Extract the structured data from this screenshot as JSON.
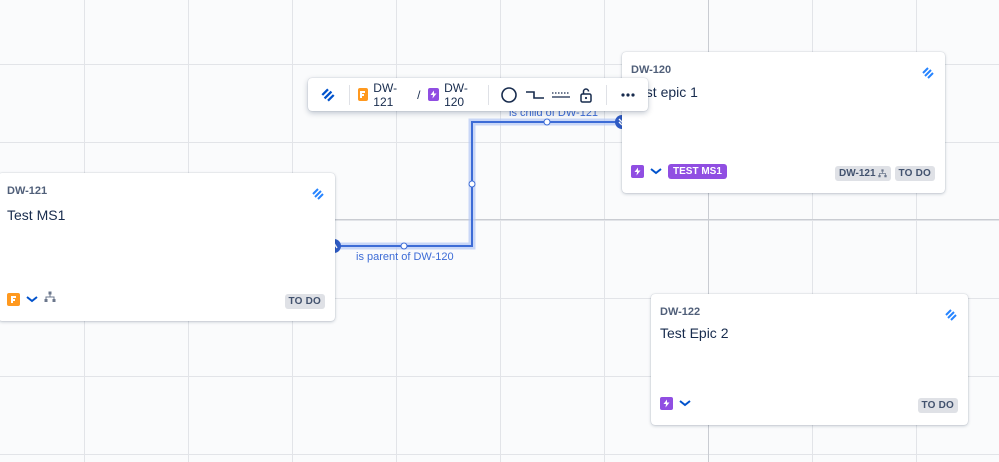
{
  "toolbar": {
    "breadcrumb_from": "DW-121",
    "breadcrumb_separator": "/",
    "breadcrumb_to": "DW-120",
    "icons": [
      "jira-icon",
      "circle-shape-icon",
      "elbow-connector-icon",
      "dotted-line-icon",
      "lock-icon",
      "more-icon"
    ]
  },
  "edges": {
    "child_label": "is child of DW-121",
    "parent_label": "is parent of DW-120"
  },
  "cards": {
    "ms1": {
      "key": "DW-121",
      "title": "Test MS1",
      "status": "TO DO",
      "type": "feature"
    },
    "epic1": {
      "key": "DW-120",
      "title": "Test epic 1",
      "epic_label": "TEST MS1",
      "parent_key": "DW-121",
      "status": "TO DO",
      "type": "epic"
    },
    "epic2": {
      "key": "DW-122",
      "title": "Test Epic 2",
      "status": "TO DO",
      "type": "epic"
    }
  },
  "colors": {
    "accent": "#3d6cd6",
    "feature": "#ff991f",
    "epic": "#904ee2",
    "status_bg": "#dfe1e6"
  }
}
